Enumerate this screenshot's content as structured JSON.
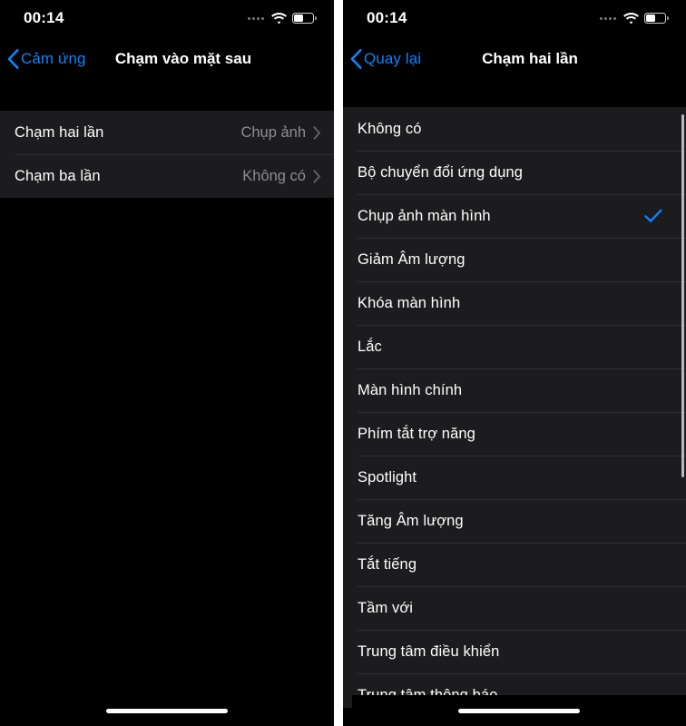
{
  "theme": {
    "background": "#000000",
    "row_background": "#1C1C1E",
    "separator": "#2F2F31",
    "accent_blue": "#0A84FF",
    "secondary_text": "#8E8E93",
    "primary_text": "#FFFFFF"
  },
  "left_screen": {
    "status": {
      "time": "00:14",
      "signal_icon": "signal-dots-icon",
      "wifi_icon": "wifi-icon",
      "battery_icon": "battery-icon",
      "battery_level": 44
    },
    "nav": {
      "back_icon": "chevron-left-icon",
      "back_label": "Cảm ứng",
      "title": "Chạm vào mặt sau"
    },
    "rows": [
      {
        "label": "Chạm hai lần",
        "value": "Chụp ảnh",
        "disclosure_icon": "chevron-right-icon"
      },
      {
        "label": "Chạm ba lần",
        "value": "Không có",
        "disclosure_icon": "chevron-right-icon"
      }
    ]
  },
  "right_screen": {
    "status": {
      "time": "00:14",
      "signal_icon": "signal-dots-icon",
      "wifi_icon": "wifi-icon",
      "battery_icon": "battery-icon",
      "battery_level": 44
    },
    "nav": {
      "back_icon": "chevron-left-icon",
      "back_label": "Quay lại",
      "title": "Chạm hai lần"
    },
    "selected_option": "Chụp ảnh màn hình",
    "check_icon": "checkmark-icon",
    "options": [
      {
        "label": "Không có",
        "selected": false
      },
      {
        "label": "Bộ chuyển đổi ứng dụng",
        "selected": false
      },
      {
        "label": "Chụp ảnh màn hình",
        "selected": true
      },
      {
        "label": "Giảm Âm lượng",
        "selected": false
      },
      {
        "label": "Khóa màn hình",
        "selected": false
      },
      {
        "label": "Lắc",
        "selected": false
      },
      {
        "label": "Màn hình chính",
        "selected": false
      },
      {
        "label": "Phím tắt trợ năng",
        "selected": false
      },
      {
        "label": "Spotlight",
        "selected": false
      },
      {
        "label": "Tăng Âm lượng",
        "selected": false
      },
      {
        "label": "Tắt tiếng",
        "selected": false
      },
      {
        "label": "Tầm với",
        "selected": false
      },
      {
        "label": "Trung tâm điều khiển",
        "selected": false
      },
      {
        "label": "Trung tâm thông báo",
        "selected": false
      }
    ]
  }
}
